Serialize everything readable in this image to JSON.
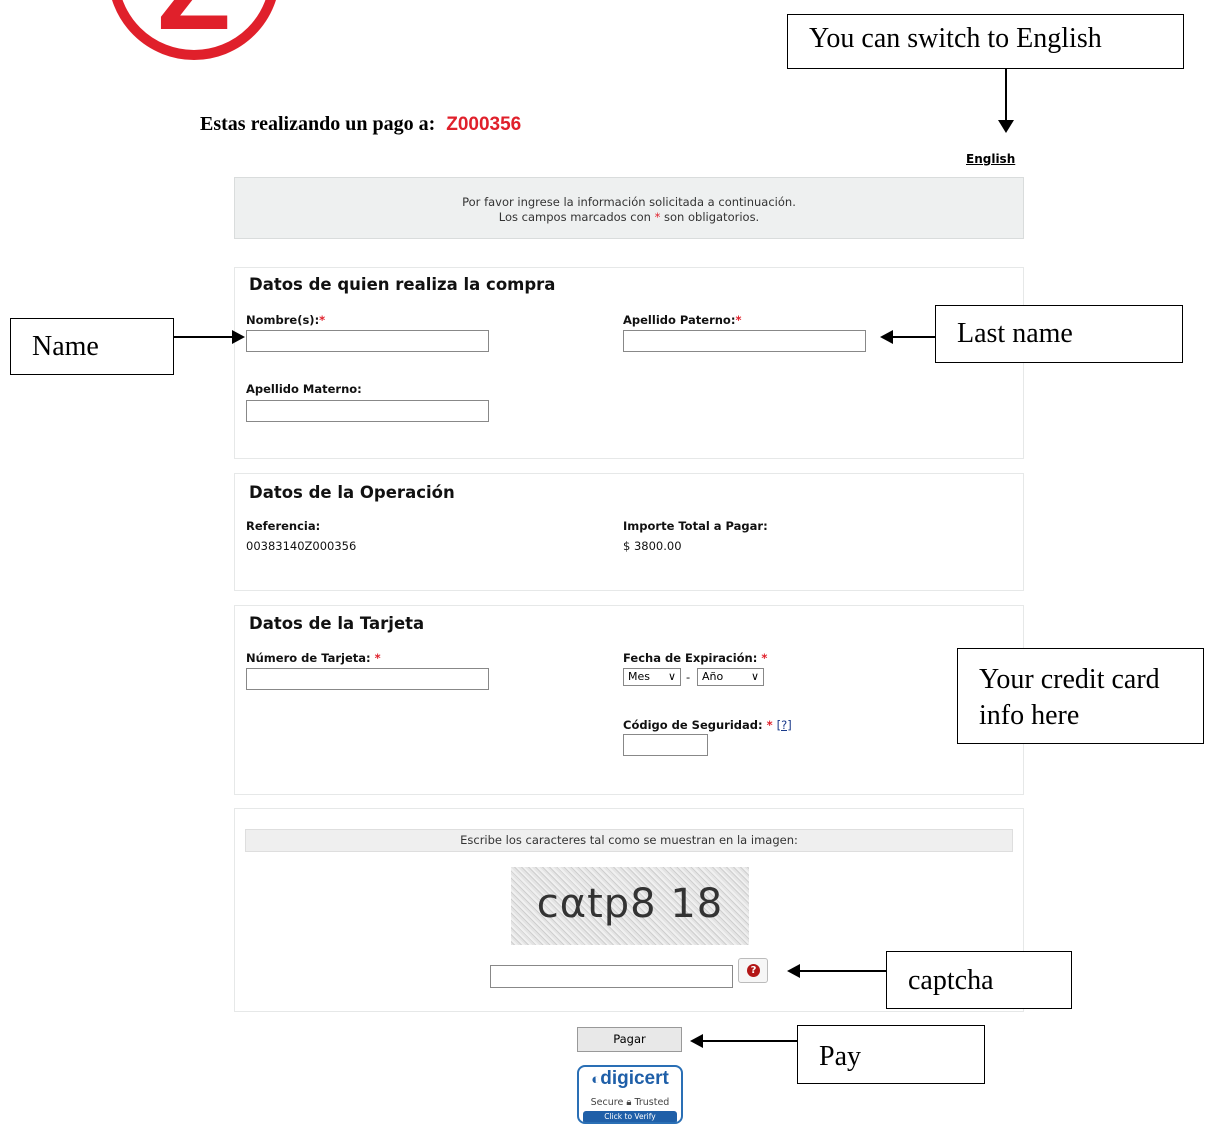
{
  "logo_letter": "Z",
  "header": {
    "pay_to_label": "Estas realizando un pago a:",
    "merchant": "Z000356",
    "english_link": "English"
  },
  "info": {
    "line1": "Por favor ingrese la información solicitada a continuación.",
    "line2_pre": "Los campos marcados con",
    "line2_star": "*",
    "line2_post": "son obligatorios."
  },
  "buyer": {
    "title": "Datos de quien realiza la compra",
    "nombre_label": "Nombre(s):",
    "apellido_paterno_label": "Apellido Paterno:",
    "apellido_materno_label": "Apellido Materno:",
    "required_mark": "*"
  },
  "operation": {
    "title": "Datos de la Operación",
    "referencia_label": "Referencia:",
    "referencia_value": "00383140Z000356",
    "importe_label": "Importe Total a Pagar:",
    "importe_value": "$ 3800.00"
  },
  "card": {
    "title": "Datos de la Tarjeta",
    "numero_label": "Número de Tarjeta:",
    "fecha_label": "Fecha de Expiración:",
    "mes_selected": "Mes",
    "separator": "-",
    "anio_selected": "Año",
    "codigo_label": "Código de Seguridad:",
    "help_link": "[?]",
    "required_mark": "*"
  },
  "captcha": {
    "instruction": "Escribe los caracteres tal como se muestran en la imagen:",
    "image_text": "cαtp8 18"
  },
  "actions": {
    "pay_button": "Pagar"
  },
  "digicert": {
    "brand": "digicert",
    "line1": "Secure",
    "line2": "Trusted",
    "verify": "Click to Verify"
  },
  "annotations": {
    "english": "You can switch to English",
    "name": "Name",
    "last_name": "Last name",
    "credit_card": "Your credit card info here",
    "captcha": "captcha",
    "pay": "Pay"
  }
}
